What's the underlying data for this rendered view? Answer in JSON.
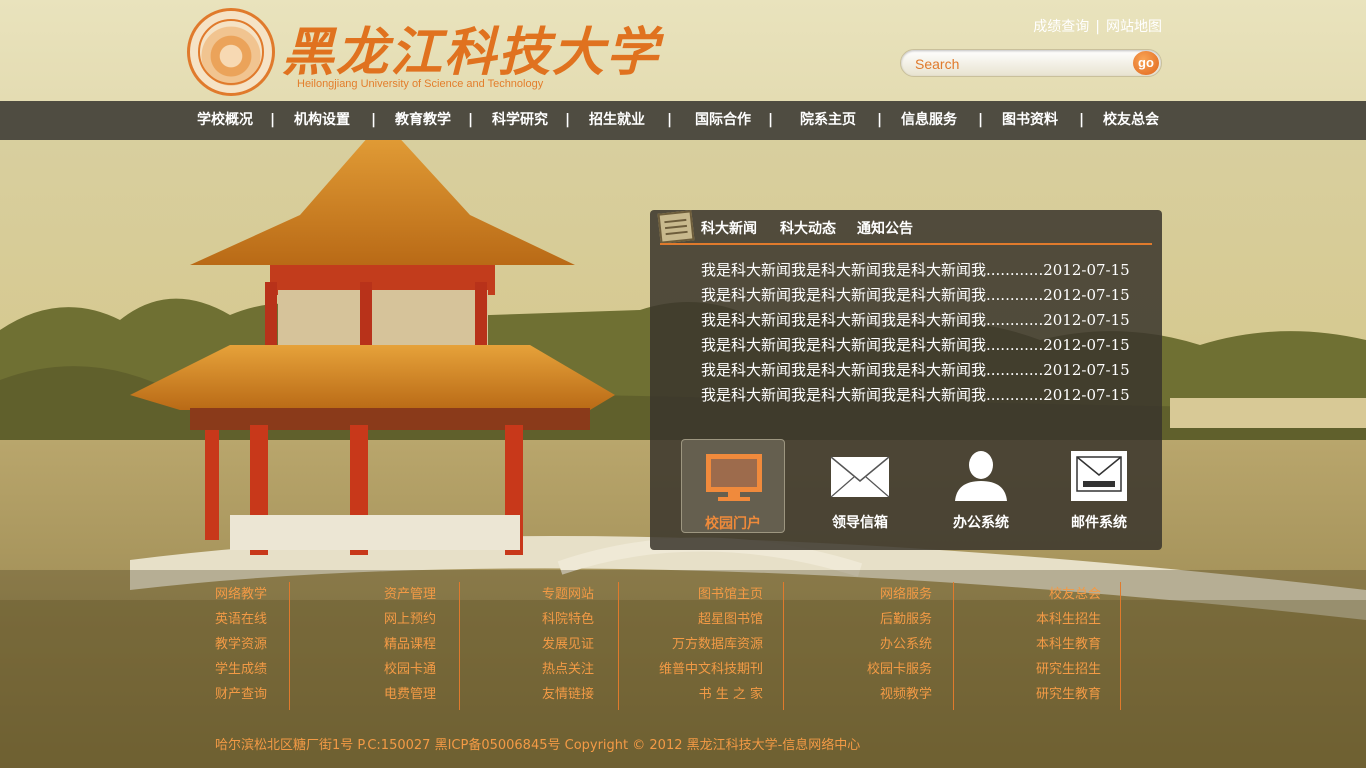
{
  "header": {
    "school_name": "黑龙江科技大学",
    "school_name_en": "Heilongjiang University of Science and Technology",
    "top_links": [
      "成绩查询",
      "网站地图"
    ],
    "search": {
      "placeholder": "Search",
      "go_label": "go"
    }
  },
  "nav": {
    "items": [
      "学校概况",
      "机构设置",
      "教育教学",
      "科学研究",
      "招生就业",
      "国际合作",
      "院系主页",
      "信息服务",
      "图书资料",
      "校友总会"
    ]
  },
  "panel": {
    "tabs": [
      "科大新闻",
      "科大动态",
      "通知公告"
    ],
    "news": [
      "我是科大新闻我是科大新闻我是科大新闻我............2012-07-15",
      "我是科大新闻我是科大新闻我是科大新闻我............2012-07-15",
      "我是科大新闻我是科大新闻我是科大新闻我............2012-07-15",
      "我是科大新闻我是科大新闻我是科大新闻我............2012-07-15",
      "我是科大新闻我是科大新闻我是科大新闻我............2012-07-15",
      "我是科大新闻我是科大新闻我是科大新闻我............2012-07-15"
    ],
    "quick_links": [
      {
        "label": "校园门户",
        "icon": "monitor-icon"
      },
      {
        "label": "领导信箱",
        "icon": "envelope-icon"
      },
      {
        "label": "办公系统",
        "icon": "user-icon"
      },
      {
        "label": "邮件系统",
        "icon": "mail-inbox-icon"
      }
    ]
  },
  "footer": {
    "columns": [
      [
        "网络教学",
        "英语在线",
        "教学资源",
        "学生成绩",
        "财产查询"
      ],
      [
        "资产管理",
        "网上预约",
        "精品课程",
        "校园卡通",
        "电费管理"
      ],
      [
        "专题网站",
        "科院特色",
        "发展见证",
        "热点关注",
        "友情链接"
      ],
      [
        "图书馆主页",
        "超星图书馆",
        "万方数据库资源",
        "维普中文科技期刊",
        "书 生 之 家"
      ],
      [
        "网络服务",
        "后勤服务",
        "办公系统",
        "校园卡服务",
        "视频教学"
      ],
      [
        "校友总会",
        "本科生招生",
        "本科生教育",
        "研究生招生",
        "研究生教育"
      ]
    ],
    "copyright": "哈尔滨松北区糖厂街1号 P.C:150027  黑ICP备05006845号   Copyright © 2012  黑龙江科技大学-信息网络中心"
  },
  "colors": {
    "accent": "#e07a2c",
    "nav_bg": "#4f4c41",
    "panel_bg": "#3a362c",
    "footer_link": "#f39a45"
  }
}
